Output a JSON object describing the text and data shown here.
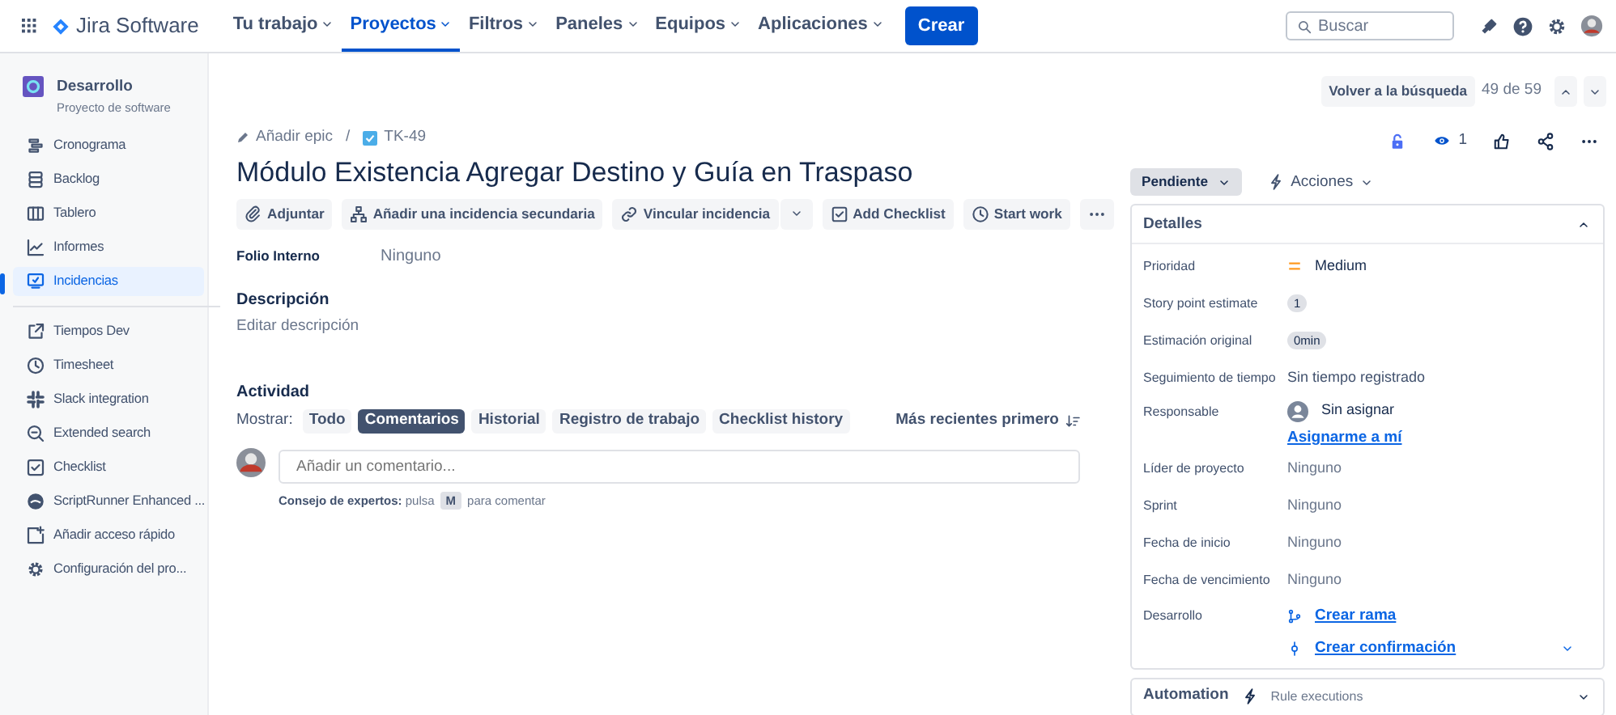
{
  "topnav": {
    "product": "Jira Software",
    "menus": [
      {
        "label": "Tu trabajo",
        "selected": false
      },
      {
        "label": "Proyectos",
        "selected": true
      },
      {
        "label": "Filtros",
        "selected": false
      },
      {
        "label": "Paneles",
        "selected": false
      },
      {
        "label": "Equipos",
        "selected": false
      },
      {
        "label": "Aplicaciones",
        "selected": false
      }
    ],
    "create": "Crear",
    "search_placeholder": "Buscar"
  },
  "sidebar": {
    "project": {
      "name": "Desarrollo",
      "type": "Proyecto de software"
    },
    "groups": [
      [
        {
          "label": "Cronograma",
          "selected": false
        },
        {
          "label": "Backlog",
          "selected": false
        },
        {
          "label": "Tablero",
          "selected": false
        },
        {
          "label": "Informes",
          "selected": false
        },
        {
          "label": "Incidencias",
          "selected": true
        }
      ],
      [
        {
          "label": "Tiempos Dev",
          "selected": false
        },
        {
          "label": "Timesheet",
          "selected": false
        },
        {
          "label": "Slack integration",
          "selected": false
        },
        {
          "label": "Extended search",
          "selected": false
        },
        {
          "label": "Checklist",
          "selected": false
        },
        {
          "label": "ScriptRunner Enhanced ...",
          "selected": false
        },
        {
          "label": "Añadir acceso rápido",
          "selected": false
        },
        {
          "label": "Configuración del pro...",
          "selected": false
        }
      ]
    ]
  },
  "search_nav": {
    "back": "Volver a la búsqueda",
    "position": "49 de 59"
  },
  "issue": {
    "breadcrumb": [
      "Añadir epic",
      "/",
      "TK-49"
    ],
    "title": "Módulo Existencia Agregar Destino y Guía en Traspaso",
    "toolbar": [
      {
        "label": "Adjuntar",
        "dropdown": false
      },
      {
        "label": "Añadir una incidencia secundaria",
        "dropdown": false
      },
      {
        "label": "Vincular incidencia",
        "dropdown": true
      },
      {
        "label": "Add Checklist",
        "dropdown": false
      },
      {
        "label": "Start work",
        "dropdown": false
      }
    ],
    "fields": [
      {
        "label": "Folio Interno",
        "value": "Ninguno"
      }
    ],
    "description": {
      "heading": "Descripción",
      "placeholder": "Editar descripción"
    },
    "activity": {
      "heading": "Actividad",
      "show_label": "Mostrar:",
      "filters": [
        {
          "label": "Todo",
          "selected": false
        },
        {
          "label": "Comentarios",
          "selected": true
        },
        {
          "label": "Historial",
          "selected": false
        },
        {
          "label": "Registro de trabajo",
          "selected": false
        },
        {
          "label": "Checklist history",
          "selected": false
        }
      ],
      "sort": "Más recientes primero",
      "comment_placeholder": "Añadir un comentario...",
      "tip": "**Consejo de expertos:** pulsa",
      "tip_key": "M",
      "tip_end": "para comentar"
    }
  },
  "watchers": "1",
  "status": "Pendiente",
  "actions": "Acciones",
  "details": {
    "title": "Detalles",
    "expanded": true,
    "rows": [
      {
        "label": "Prioridad",
        "kind": "priority",
        "value": "Medium"
      },
      {
        "label": "Story point estimate",
        "kind": "badge",
        "value": "1"
      },
      {
        "label": "Estimación original",
        "kind": "badge",
        "value": "0min"
      },
      {
        "label": "Seguimiento de tiempo",
        "kind": "text",
        "value": "Sin tiempo registrado"
      },
      {
        "label": "Responsable",
        "kind": "assignee",
        "value": "Sin asignar",
        "link": "Asignarme a mí"
      },
      {
        "label": "Líder de proyecto",
        "kind": "empty",
        "value": "Ninguno"
      },
      {
        "label": "Sprint",
        "kind": "empty",
        "value": "Ninguno"
      },
      {
        "label": "Fecha de inicio",
        "kind": "empty",
        "value": "Ninguno"
      },
      {
        "label": "Fecha de vencimiento",
        "kind": "empty",
        "value": "Ninguno"
      },
      {
        "label": "Desarrollo",
        "kind": "development",
        "links": [
          "Crear rama",
          "Crear confirmación"
        ]
      }
    ]
  },
  "automation": {
    "title": "Automation",
    "subtitle": "Rule executions"
  }
}
